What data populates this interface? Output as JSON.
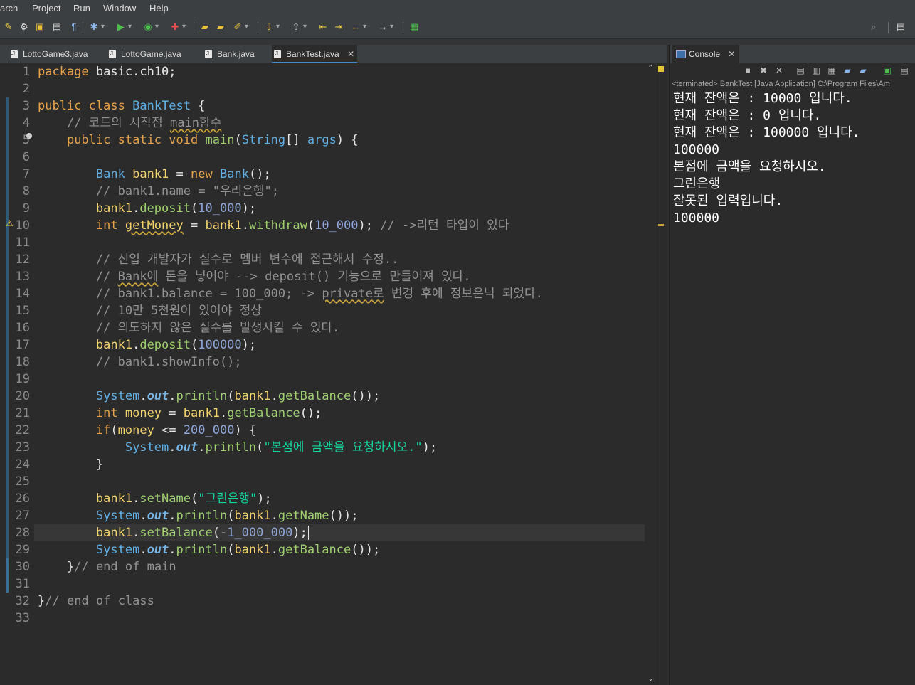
{
  "menu": [
    "arch",
    "Project",
    "Run",
    "Window",
    "Help"
  ],
  "tabs": [
    {
      "label": "LottoGame3.java"
    },
    {
      "label": "LottoGame.java"
    },
    {
      "label": "Bank.java"
    },
    {
      "label": "BankTest.java",
      "active": true
    }
  ],
  "editor": {
    "line_numbers": [
      "1",
      "2",
      "3",
      "4",
      "5",
      "6",
      "7",
      "8",
      "9",
      "10",
      "11",
      "12",
      "13",
      "14",
      "15",
      "16",
      "17",
      "18",
      "19",
      "20",
      "21",
      "22",
      "23",
      "24",
      "25",
      "26",
      "27",
      "28",
      "29",
      "30",
      "31",
      "32",
      "33"
    ],
    "current_line": 28,
    "lines": [
      "package basic.ch10;",
      "",
      "public class BankTest {",
      "    // 코드의 시작점 main함수",
      "    public static void main(String[] args) {",
      "",
      "        Bank bank1 = new Bank();",
      "        // bank1.name = \"우리은행\";",
      "        bank1.deposit(10_000);",
      "        int getMoney = bank1.withdraw(10_000); // ->리턴 타입이 있다",
      "",
      "        // 신입 개발자가 실수로 멤버 변수에 접근해서 수정..",
      "        // Bank에 돈을 넣어야 --> deposit() 기능으로 만들어져 있다.",
      "        // bank1.balance = 100_000; -> private로 변경 후에 정보은닉 되었다.",
      "        // 10만 5천원이 있어야 정상",
      "        // 의도하지 않은 실수를 발생시킬 수 있다.",
      "        bank1.deposit(100000);",
      "        // bank1.showInfo();",
      "",
      "        System.out.println(bank1.getBalance());",
      "        int money = bank1.getBalance();",
      "        if(money <= 200_000) {",
      "            System.out.println(\"본점에 금액을 요청하시오.\");",
      "        }",
      "",
      "        bank1.setName(\"그린은행\");",
      "        System.out.println(bank1.getName());",
      "        bank1.setBalance(-1_000_000);",
      "        System.out.println(bank1.getBalance());",
      "    }// end of main",
      "",
      "}// end of class",
      ""
    ]
  },
  "console": {
    "tab_label": "Console",
    "description": "<terminated> BankTest [Java Application] C:\\Program Files\\Am",
    "output": [
      "현재 잔액은 : 10000 입니다.",
      "현재 잔액은 : 0 입니다.",
      "현재 잔액은 : 100000 입니다.",
      "100000",
      "본점에 금액을 요청하시오.",
      "그린은행",
      "잘못된 입력입니다.",
      "100000"
    ]
  },
  "colors": {
    "keyword": "#e6a24b",
    "type": "#5fb0e6",
    "method": "#9fcf6f",
    "string": "#14d39c",
    "comment": "#929292",
    "variable": "#f2d36e",
    "background": "#2b2b2b"
  }
}
